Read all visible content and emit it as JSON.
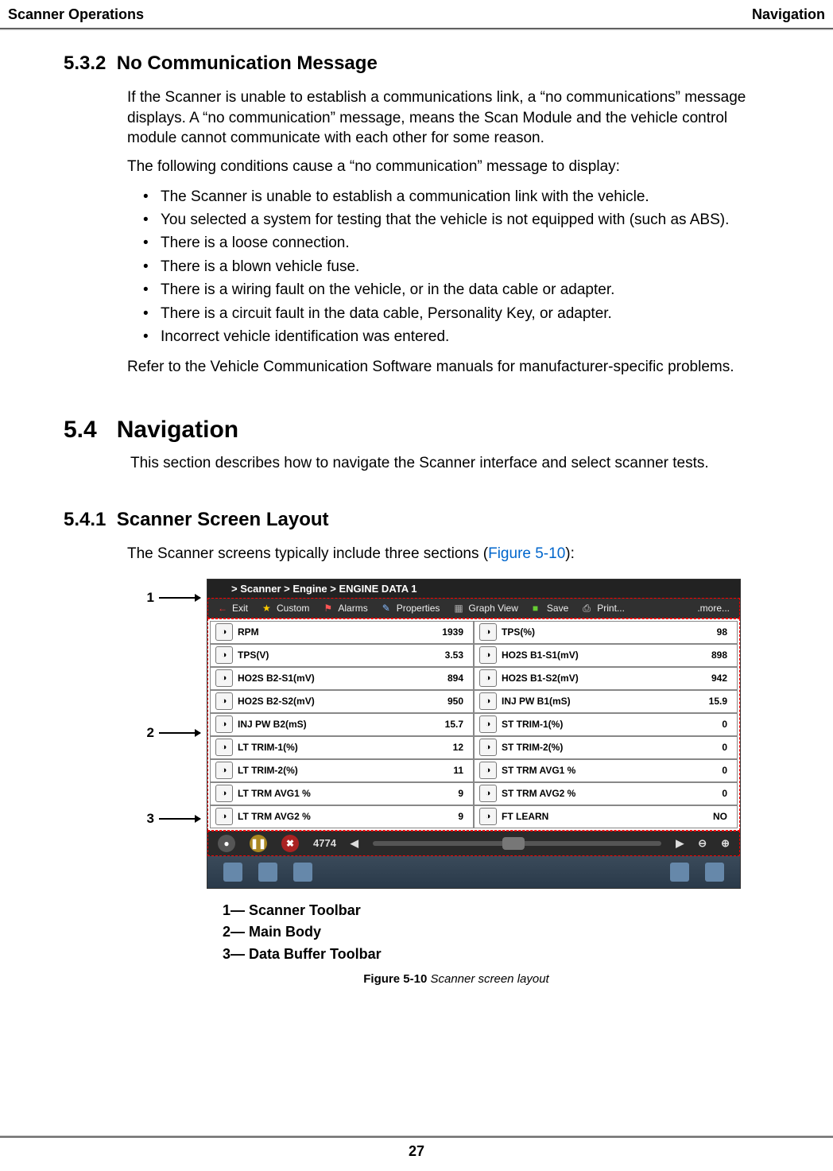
{
  "header": {
    "left": "Scanner Operations",
    "right": "Navigation"
  },
  "s532": {
    "num": "5.3.2",
    "title": "No Communication Message",
    "p1": "If the Scanner is unable to establish a communications link, a “no communications” message displays. A “no communication” message, means the Scan Module and the vehicle control module cannot communicate with each other for some reason.",
    "p2": "The following conditions cause a “no communication” message to display:",
    "bullets": [
      "The Scanner is unable to establish a communication link with the vehicle.",
      "You selected a system for testing that the vehicle is not equipped with (such as ABS).",
      "There is a loose connection.",
      "There is a blown vehicle fuse.",
      "There is a wiring fault on the vehicle, or in the data cable or adapter.",
      "There is a circuit fault in the data cable, Personality Key, or adapter.",
      "Incorrect vehicle identification was entered."
    ],
    "p3": "Refer to the Vehicle Communication Software manuals for manufacturer-specific problems."
  },
  "s54": {
    "num": "5.4",
    "title": "Navigation",
    "p1": "This section describes how to navigate the Scanner interface and select scanner tests."
  },
  "s541": {
    "num": "5.4.1",
    "title": "Scanner Screen Layout",
    "p1a": "The Scanner screens typically include three sections (",
    "figref": "Figure 5-10",
    "p1b": "):"
  },
  "callouts": {
    "c1": "1",
    "c2": "2",
    "c3": "3"
  },
  "scanner": {
    "breadcrumb": "> Scanner  > Engine  > ENGINE DATA 1",
    "toolbar": {
      "exit": "Exit",
      "custom": "Custom",
      "alarms": "Alarms",
      "properties": "Properties",
      "graph": "Graph View",
      "save": "Save",
      "print": "Print...",
      "more": ".more..."
    },
    "rows": [
      {
        "l": {
          "n": "RPM",
          "v": "1939"
        },
        "r": {
          "n": "TPS(%)",
          "v": "98"
        }
      },
      {
        "l": {
          "n": "TPS(V)",
          "v": "3.53"
        },
        "r": {
          "n": "HO2S B1-S1(mV)",
          "v": "898"
        }
      },
      {
        "l": {
          "n": "HO2S B2-S1(mV)",
          "v": "894"
        },
        "r": {
          "n": "HO2S B1-S2(mV)",
          "v": "942"
        }
      },
      {
        "l": {
          "n": "HO2S B2-S2(mV)",
          "v": "950"
        },
        "r": {
          "n": "INJ PW B1(mS)",
          "v": "15.9"
        }
      },
      {
        "l": {
          "n": "INJ PW B2(mS)",
          "v": "15.7"
        },
        "r": {
          "n": "ST TRIM-1(%)",
          "v": "0"
        }
      },
      {
        "l": {
          "n": "LT TRIM-1(%)",
          "v": "12"
        },
        "r": {
          "n": "ST TRIM-2(%)",
          "v": "0"
        }
      },
      {
        "l": {
          "n": "LT TRIM-2(%)",
          "v": "11"
        },
        "r": {
          "n": "ST TRM AVG1 %",
          "v": "0"
        }
      },
      {
        "l": {
          "n": "LT TRM AVG1 %",
          "v": "9"
        },
        "r": {
          "n": "ST TRM AVG2 %",
          "v": "0"
        }
      },
      {
        "l": {
          "n": "LT TRM AVG2 %",
          "v": "9"
        },
        "r": {
          "n": "FT LEARN",
          "v": "NO"
        }
      }
    ],
    "buffer_frame": "4774"
  },
  "legend": {
    "l1": "1— Scanner Toolbar",
    "l2": "2— Main Body",
    "l3": "3— Data Buffer Toolbar"
  },
  "caption": {
    "label": "Figure 5-10 ",
    "title": "Scanner screen layout"
  },
  "page": "27"
}
